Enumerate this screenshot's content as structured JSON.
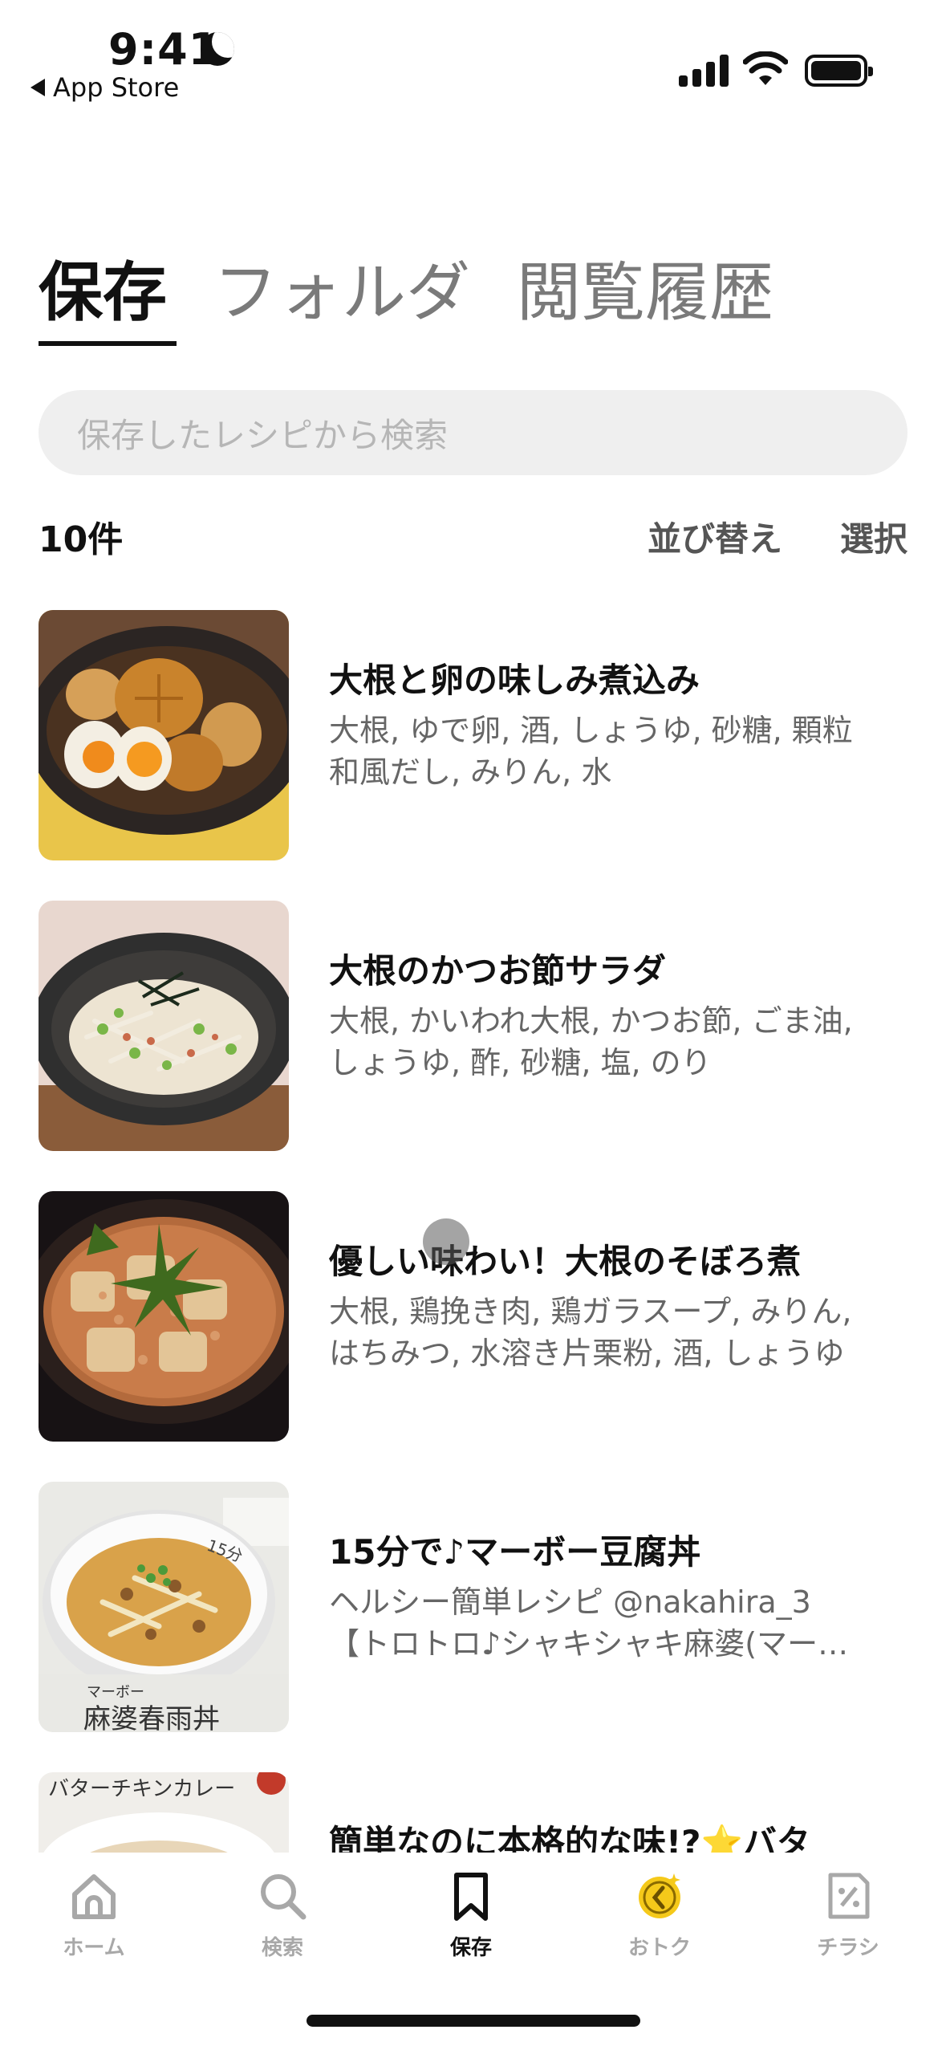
{
  "status": {
    "time": "9:41",
    "back_label": "App Store"
  },
  "tabs": [
    {
      "label": "保存",
      "active": true
    },
    {
      "label": "フォルダ",
      "active": false
    },
    {
      "label": "閲覧履歴",
      "active": false
    }
  ],
  "search": {
    "placeholder": "保存したレシピから検索"
  },
  "list_header": {
    "count": "10件",
    "sort_label": "並び替え",
    "select_label": "選択"
  },
  "recipes": [
    {
      "title": "大根と卵の味しみ煮込み",
      "desc1": "大根, ゆで卵, 酒, しょうゆ, 砂糖, 顆粒",
      "desc2": "和風だし, みりん, 水"
    },
    {
      "title": "大根のかつお節サラダ",
      "desc1": "大根, かいわれ大根, かつお節, ごま油,",
      "desc2": "しょうゆ, 酢, 砂糖, 塩, のり"
    },
    {
      "title": "優しい味わい！大根のそぼろ煮",
      "desc1": "大根, 鶏挽き肉, 鶏ガラスープ, みりん,",
      "desc2": "はちみつ, 水溶き片栗粉, 酒, しょうゆ"
    },
    {
      "title": "15分で♪マーボー豆腐丼",
      "desc1": "ヘルシー簡単レシピ @nakahira_3",
      "desc2": "【トロトロ♪シャキシャキ麻婆(マー…",
      "thumb_small": "マーボー",
      "thumb_text": "麻婆春雨丼",
      "thumb_badge": "15分"
    },
    {
      "title": "簡単なのに本格的な味!?⭐バタ",
      "thumb_text": "バターチキンカレー"
    }
  ],
  "tabbar": [
    {
      "label": "ホーム",
      "icon": "home-icon",
      "active": false
    },
    {
      "label": "検索",
      "icon": "search-icon",
      "active": false
    },
    {
      "label": "保存",
      "icon": "bookmark-icon",
      "active": true
    },
    {
      "label": "おトク",
      "icon": "coin-icon",
      "active": false
    },
    {
      "label": "チラシ",
      "icon": "flyer-icon",
      "active": false
    }
  ],
  "colors": {
    "accent_coin": "#f5c91a",
    "inactive": "#a8a8a8",
    "search_bg": "#efefef"
  }
}
